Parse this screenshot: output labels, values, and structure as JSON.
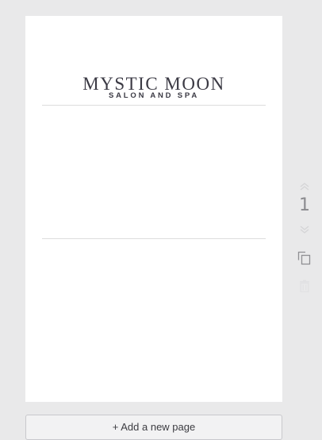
{
  "page": {
    "logo": {
      "title": "MYSTIC MOON",
      "subtitle": "SALON AND SPA"
    },
    "background_color": "#ffffff"
  },
  "page_controls": {
    "page_number": "1",
    "icons": [
      "chevron-up-icon",
      "chevron-down-icon",
      "duplicate-icon",
      "trash-icon"
    ]
  },
  "footer": {
    "add_page_label": "+ Add a new page"
  },
  "colors": {
    "canvas": "#e9e9ea",
    "text": "#3b3a44",
    "muted_icon": "#c9c9cb"
  }
}
